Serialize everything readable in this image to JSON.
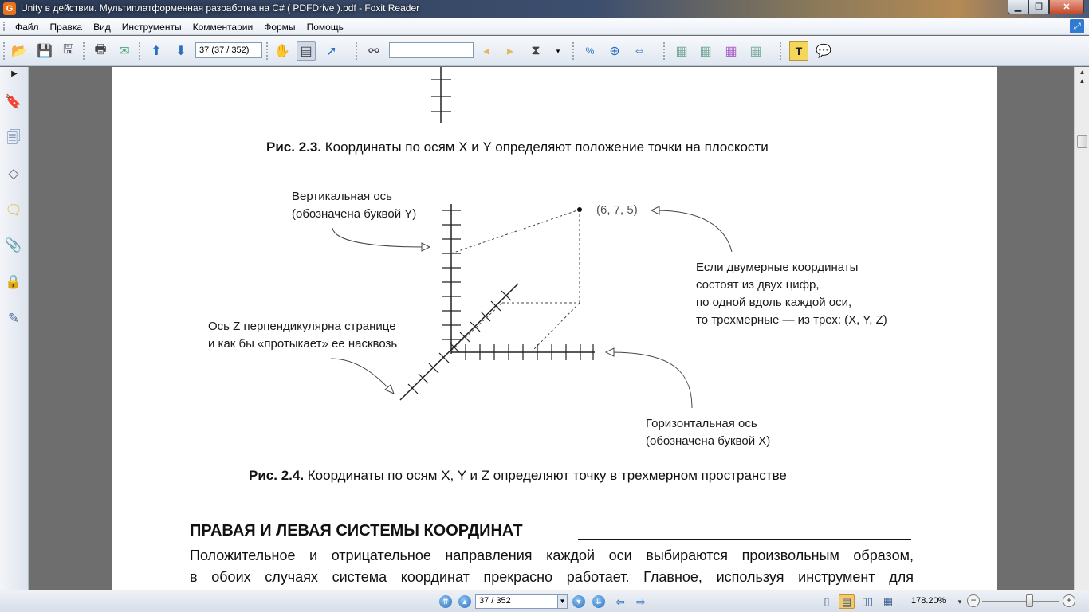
{
  "window": {
    "title": "Unity в действии. Мультиплатформенная разработка на C# ( PDFDrive ).pdf - Foxit Reader",
    "app_icon": "foxit-icon",
    "app_icon_letter": "G"
  },
  "menu": {
    "items": [
      "Файл",
      "Правка",
      "Вид",
      "Инструменты",
      "Комментарии",
      "Формы",
      "Помощь"
    ]
  },
  "toolbar": {
    "page_field": "37 (37 / 352)",
    "find_field": ""
  },
  "document": {
    "fig23_caption": {
      "label": "Рис. 2.3.",
      "text": " Координаты по осям X и Y определяют положение точки на плоскости"
    },
    "fig24": {
      "y_axis_label": [
        "Вертикальная ось",
        "(обозначена буквой Y)"
      ],
      "point_label": "(6, 7, 5)",
      "explain_label": [
        "Если двумерные координаты",
        "состоят из двух цифр,",
        "по одной вдоль каждой оси,",
        "то трехмерные — из трех: (X, Y, Z)"
      ],
      "z_axis_label": [
        "Ось Z перпендикулярна странице",
        "и как бы «протыкает» ее насквозь"
      ],
      "x_axis_label": [
        "Горизонтальная ось",
        "(обозначена буквой X)"
      ]
    },
    "fig24_caption": {
      "label": "Рис. 2.4.",
      "text": " Координаты по осям X, Y и Z определяют точку в трехмерном пространстве"
    },
    "section_heading": "ПРАВАЯ И ЛЕВАЯ СИСТЕМЫ КООРДИНАТ",
    "paragraph_lines": [
      "Положительное и отрицательное направления каждой оси выбираются произвольным образом,",
      "в обоих случаях система координат прекрасно работает. Главное, используя инструмент для"
    ]
  },
  "statusbar": {
    "page_field": "37 / 352",
    "zoom": "178.20%"
  },
  "colors": {
    "doc_background": "#6e6e6e",
    "page": "#ffffff",
    "accent_blue": "#2a6fbd"
  }
}
